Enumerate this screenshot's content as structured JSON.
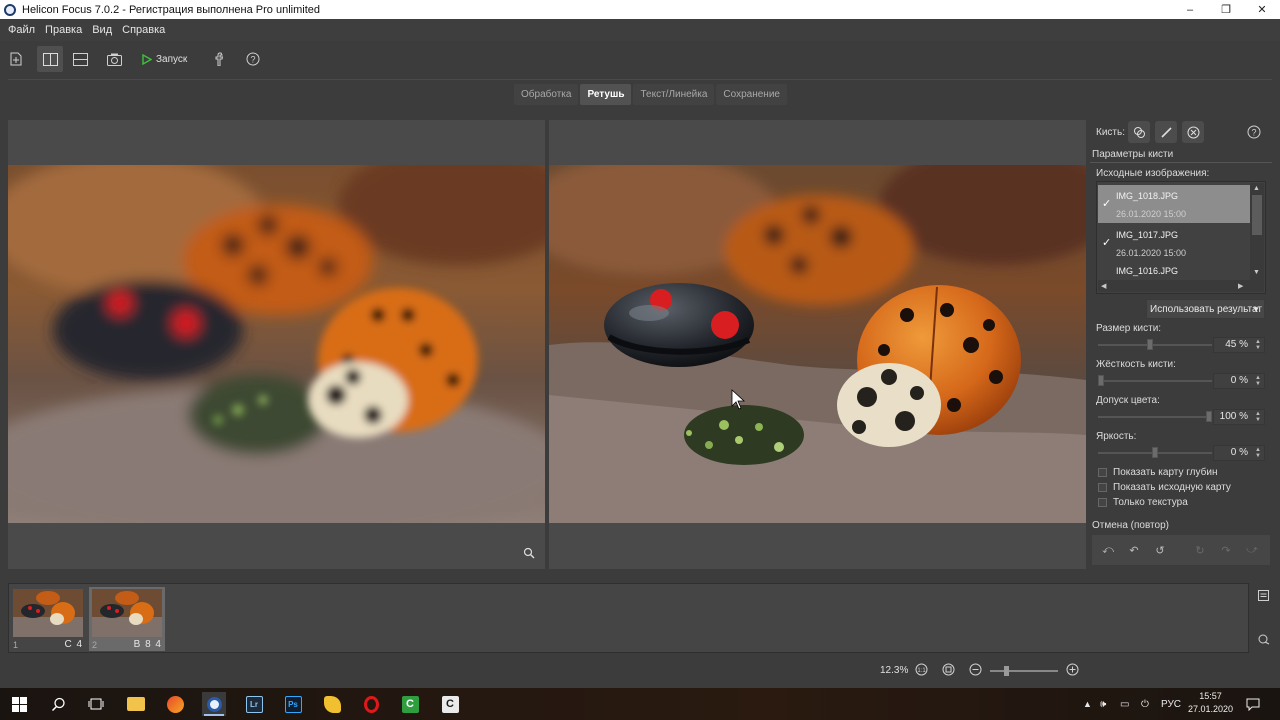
{
  "window": {
    "title": "Helicon Focus 7.0.2 - Регистрация выполнена Pro unlimited",
    "minimize": "–",
    "maximize": "❐",
    "close": "✕"
  },
  "menu": [
    "Файл",
    "Правка",
    "Вид",
    "Справка"
  ],
  "toolbar": {
    "run_label": "Запуск"
  },
  "tabs": [
    {
      "label": "Обработка",
      "active": false
    },
    {
      "label": "Ретушь",
      "active": true
    },
    {
      "label": "Текст/Линейка",
      "active": false
    },
    {
      "label": "Сохранение",
      "active": false
    }
  ],
  "side": {
    "brushes_label": "Кисть:",
    "brush_params_label": "Параметры кисти",
    "source_images_label": "Исходные изображения:",
    "source_images": [
      {
        "name": "IMG_1018.JPG",
        "date": "26.01.2020 15:00",
        "checked": true,
        "selected": true
      },
      {
        "name": "IMG_1017.JPG",
        "date": "26.01.2020 15:00",
        "checked": true,
        "selected": false
      },
      {
        "name": "IMG_1016.JPG",
        "date": "",
        "checked": false,
        "selected": false
      }
    ],
    "use_result_label": "Использовать результат",
    "brush_size": {
      "label": "Размер кисти:",
      "value": "45 %",
      "level": 0.45
    },
    "brush_hardness": {
      "label": "Жёсткость кисти:",
      "value": "0 %",
      "level": 0.0
    },
    "color_tolerance": {
      "label": "Допуск цвета:",
      "value": "100 %",
      "level": 1.0
    },
    "brightness": {
      "label": "Яркость:",
      "value": "0 %",
      "level": 0.5
    },
    "checkboxes": [
      "Показать карту глубин",
      "Показать исходную карту",
      "Только текстура"
    ],
    "undo_label": "Отмена (повтор)"
  },
  "filmstrip": [
    {
      "num": "1",
      "tag": "C 4",
      "selected": false
    },
    {
      "num": "2",
      "tag": "B 8 4",
      "selected": true
    }
  ],
  "status": {
    "zoom": "12.3%"
  },
  "taskbar": {
    "lang": "РУС",
    "time": "15:57",
    "date": "27.01.2020"
  },
  "colors": {
    "background": "#3c3c3c",
    "panel": "#4a4a4a",
    "selected_item": "#8d8d8d",
    "ladybug_orange": "#d86d16",
    "ladybug_black": "#1c1f24",
    "spot_red": "#d81e20"
  }
}
